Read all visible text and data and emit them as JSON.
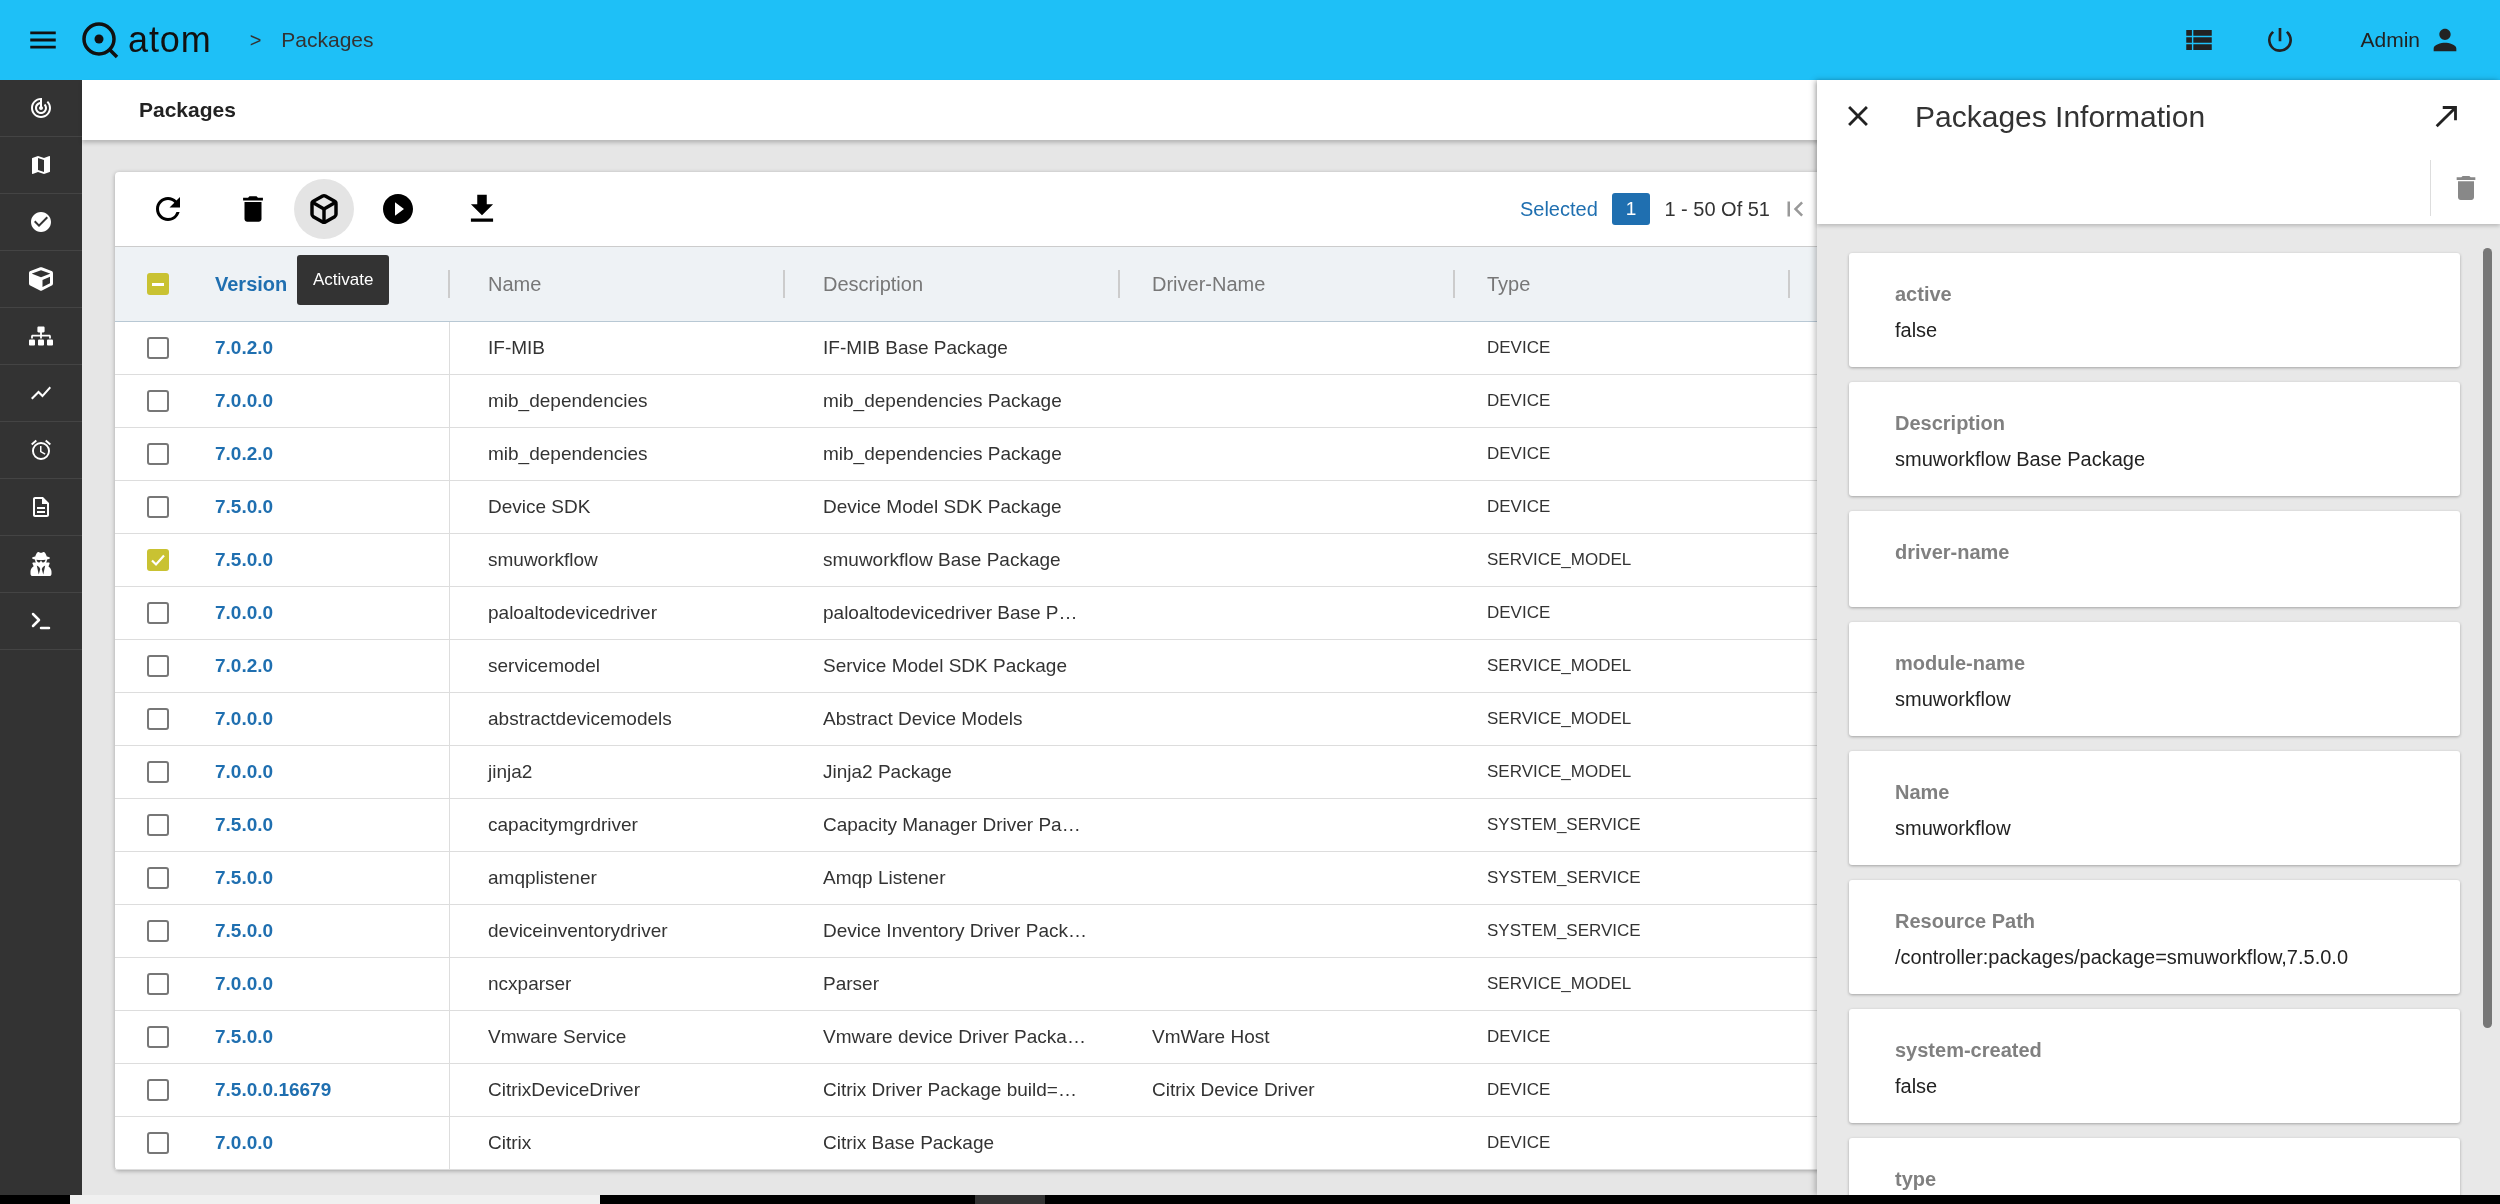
{
  "topbar": {
    "brand": "atom",
    "breadcrumb_separator": ">",
    "breadcrumb": "Packages",
    "user": "Admin"
  },
  "page_title": "Packages",
  "toolbar": {
    "tooltip": "Activate",
    "selected_label": "Selected",
    "selected_count": "1",
    "range": "1 - 50 Of 51"
  },
  "table": {
    "header_checkbox": {
      "indeterminate": true
    },
    "columns": [
      "Version",
      "Name",
      "Description",
      "Driver-Name",
      "Type"
    ],
    "rows": [
      {
        "checked": false,
        "version": "7.0.2.0",
        "name": "IF-MIB",
        "description": "IF-MIB Base Package",
        "type": "DEVICE"
      },
      {
        "checked": false,
        "version": "7.0.0.0",
        "name": "mib_dependencies",
        "description": "mib_dependencies Package",
        "type": "DEVICE"
      },
      {
        "checked": false,
        "version": "7.0.2.0",
        "name": "mib_dependencies",
        "description": "mib_dependencies Package",
        "type": "DEVICE"
      },
      {
        "checked": false,
        "version": "7.5.0.0",
        "name": "Device SDK",
        "description": "Device Model SDK Package",
        "type": "DEVICE"
      },
      {
        "checked": true,
        "version": "7.5.0.0",
        "name": "smuworkflow",
        "description": "smuworkflow Base Package",
        "type": "SERVICE_MODEL"
      },
      {
        "checked": false,
        "version": "7.0.0.0",
        "name": "paloaltodevicedriver",
        "description": "paloaltodevicedriver Base P…",
        "type": "DEVICE"
      },
      {
        "checked": false,
        "version": "7.0.2.0",
        "name": "servicemodel",
        "description": "Service Model SDK Package",
        "type": "SERVICE_MODEL"
      },
      {
        "checked": false,
        "version": "7.0.0.0",
        "name": "abstractdevicemodels",
        "description": "Abstract Device Models",
        "type": "SERVICE_MODEL"
      },
      {
        "checked": false,
        "version": "7.0.0.0",
        "name": "jinja2",
        "description": "Jinja2 Package",
        "type": "SERVICE_MODEL"
      },
      {
        "checked": false,
        "version": "7.5.0.0",
        "name": "capacitymgrdriver",
        "description": "Capacity Manager Driver Pa…",
        "type": "SYSTEM_SERVICE"
      },
      {
        "checked": false,
        "version": "7.5.0.0",
        "name": "amqplistener",
        "description": "Amqp Listener",
        "type": "SYSTEM_SERVICE"
      },
      {
        "checked": false,
        "version": "7.5.0.0",
        "name": "deviceinventorydriver",
        "description": "Device Inventory Driver Pack…",
        "type": "SYSTEM_SERVICE"
      },
      {
        "checked": false,
        "version": "7.0.0.0",
        "name": "ncxparser",
        "description": "Parser",
        "type": "SERVICE_MODEL"
      },
      {
        "checked": false,
        "version": "7.5.0.0",
        "name": "Vmware Service",
        "description": "Vmware device Driver Packa…",
        "driver_name": "VmWare Host",
        "type": "DEVICE"
      },
      {
        "checked": false,
        "version": "7.5.0.0.16679",
        "name": "CitrixDeviceDriver",
        "description": "Citrix Driver Package build=…",
        "driver_name": "Citrix Device Driver",
        "type": "DEVICE"
      },
      {
        "checked": false,
        "version": "7.0.0.0",
        "name": "Citrix",
        "description": "Citrix Base Package",
        "type": "DEVICE"
      }
    ]
  },
  "panel": {
    "title": "Packages Information",
    "fields": [
      {
        "label": "active",
        "value": "false"
      },
      {
        "label": "Description",
        "value": "smuworkflow Base Package"
      },
      {
        "label": "driver-name"
      },
      {
        "label": "module-name",
        "value": "smuworkflow"
      },
      {
        "label": "Name",
        "value": "smuworkflow"
      },
      {
        "label": "Resource Path",
        "value": "/controller:packages/package=smuworkflow,7.5.0.0"
      },
      {
        "label": "system-created",
        "value": "false"
      },
      {
        "label": "type"
      }
    ]
  }
}
